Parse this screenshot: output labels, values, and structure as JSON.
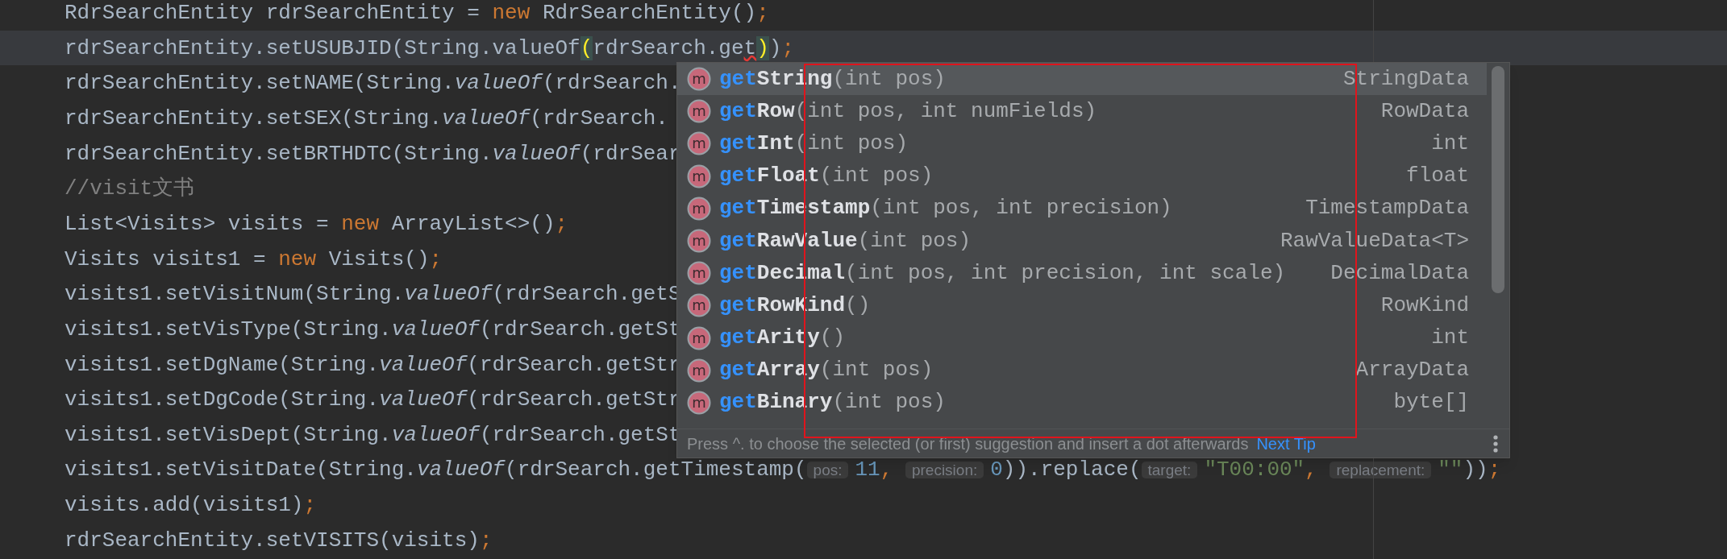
{
  "editor": {
    "lines": [
      {
        "current": false,
        "tokens": [
          {
            "kind": "plain",
            "text": "RdrSearchEntity rdrSearchEntity = "
          },
          {
            "kind": "keyword",
            "text": "new"
          },
          {
            "kind": "plain",
            "text": " RdrSearchEntity()"
          },
          {
            "kind": "keyword",
            "text": ";"
          }
        ]
      },
      {
        "current": true,
        "tokens": [
          {
            "kind": "plain",
            "text": "rdrSearchEntity.setUSUBJID(String.valueOf"
          },
          {
            "kind": "brace_match",
            "text": "("
          },
          {
            "kind": "plain",
            "text": "rdrSearch.ge"
          },
          {
            "kind": "error",
            "text": "t"
          },
          {
            "kind": "brace_match",
            "text": ")"
          },
          {
            "kind": "plain",
            "text": ")"
          },
          {
            "kind": "keyword",
            "text": ";"
          }
        ]
      },
      {
        "current": false,
        "tokens": [
          {
            "kind": "plain",
            "text": "rdrSearchEntity.setNAME(String."
          },
          {
            "kind": "italic",
            "text": "valueOf"
          },
          {
            "kind": "plain",
            "text": "(rdrSearch."
          }
        ]
      },
      {
        "current": false,
        "tokens": [
          {
            "kind": "plain",
            "text": "rdrSearchEntity.setSEX(String."
          },
          {
            "kind": "italic",
            "text": "valueOf"
          },
          {
            "kind": "plain",
            "text": "(rdrSearch."
          }
        ]
      },
      {
        "current": false,
        "tokens": [
          {
            "kind": "plain",
            "text": "rdrSearchEntity.setBRTHDTC(String."
          },
          {
            "kind": "italic",
            "text": "valueOf"
          },
          {
            "kind": "plain",
            "text": "(rdrSear"
          }
        ]
      },
      {
        "current": false,
        "tokens": [
          {
            "kind": "comment",
            "text": "//visit文书"
          }
        ]
      },
      {
        "current": false,
        "tokens": [
          {
            "kind": "plain",
            "text": "List<Visits> visits = "
          },
          {
            "kind": "keyword",
            "text": "new"
          },
          {
            "kind": "plain",
            "text": " ArrayList<>()"
          },
          {
            "kind": "keyword",
            "text": ";"
          }
        ]
      },
      {
        "current": false,
        "tokens": [
          {
            "kind": "plain",
            "text": "Visits visits1 = "
          },
          {
            "kind": "keyword",
            "text": "new"
          },
          {
            "kind": "plain",
            "text": " Visits()"
          },
          {
            "kind": "keyword",
            "text": ";"
          }
        ]
      },
      {
        "current": false,
        "tokens": [
          {
            "kind": "plain",
            "text": "visits1.setVisitNum(String."
          },
          {
            "kind": "italic",
            "text": "valueOf"
          },
          {
            "kind": "plain",
            "text": "(rdrSearch.getS"
          }
        ]
      },
      {
        "current": false,
        "tokens": [
          {
            "kind": "plain",
            "text": "visits1.setVisType(String."
          },
          {
            "kind": "italic",
            "text": "valueOf"
          },
          {
            "kind": "plain",
            "text": "(rdrSearch.getSt"
          }
        ]
      },
      {
        "current": false,
        "tokens": [
          {
            "kind": "plain",
            "text": "visits1.setDgName(String."
          },
          {
            "kind": "italic",
            "text": "valueOf"
          },
          {
            "kind": "plain",
            "text": "(rdrSearch.getStr"
          }
        ]
      },
      {
        "current": false,
        "tokens": [
          {
            "kind": "plain",
            "text": "visits1.setDgCode(String."
          },
          {
            "kind": "italic",
            "text": "valueOf"
          },
          {
            "kind": "plain",
            "text": "(rdrSearch.getStr"
          }
        ]
      },
      {
        "current": false,
        "tokens": [
          {
            "kind": "plain",
            "text": "visits1.setVisDept(String."
          },
          {
            "kind": "italic",
            "text": "valueOf"
          },
          {
            "kind": "plain",
            "text": "(rdrSearch.getSt"
          }
        ]
      },
      {
        "current": false,
        "tokens": [
          {
            "kind": "plain",
            "text": "visits1.setVisitDate(String."
          },
          {
            "kind": "italic",
            "text": "valueOf"
          },
          {
            "kind": "plain",
            "text": "(rdrSearch.getTimestamp("
          },
          {
            "kind": "hint",
            "text": "pos:"
          },
          {
            "kind": "number",
            "text": "11"
          },
          {
            "kind": "keyword",
            "text": ", "
          },
          {
            "kind": "hint",
            "text": "precision:"
          },
          {
            "kind": "number",
            "text": "0"
          },
          {
            "kind": "plain",
            "text": ")).replace("
          },
          {
            "kind": "hint",
            "text": "target:"
          },
          {
            "kind": "string",
            "text": "\"T00:00\""
          },
          {
            "kind": "keyword",
            "text": ", "
          },
          {
            "kind": "hint",
            "text": "replacement:"
          },
          {
            "kind": "string",
            "text": "\"\""
          },
          {
            "kind": "plain",
            "text": "))"
          },
          {
            "kind": "keyword",
            "text": ";"
          }
        ]
      },
      {
        "current": false,
        "tokens": [
          {
            "kind": "plain",
            "text": "visits.add(visits1)"
          },
          {
            "kind": "keyword",
            "text": ";"
          }
        ]
      },
      {
        "current": false,
        "tokens": [
          {
            "kind": "plain",
            "text": "rdrSearchEntity.setVISITS(visits)"
          },
          {
            "kind": "keyword",
            "text": ";"
          }
        ]
      }
    ]
  },
  "completion": {
    "items": [
      {
        "icon": "m",
        "match": "get",
        "rest": "String",
        "params": "(int pos)",
        "type": "StringData",
        "selected": true
      },
      {
        "icon": "m",
        "match": "get",
        "rest": "Row",
        "params": "(int pos, int numFields)",
        "type": "RowData",
        "selected": false
      },
      {
        "icon": "m",
        "match": "get",
        "rest": "Int",
        "params": "(int pos)",
        "type": "int",
        "selected": false
      },
      {
        "icon": "m",
        "match": "get",
        "rest": "Float",
        "params": "(int pos)",
        "type": "float",
        "selected": false
      },
      {
        "icon": "m",
        "match": "get",
        "rest": "Timestamp",
        "params": "(int pos, int precision)",
        "type": "TimestampData",
        "selected": false
      },
      {
        "icon": "m",
        "match": "get",
        "rest": "RawValue",
        "params": "(int pos)",
        "type": "RawValueData<T>",
        "selected": false
      },
      {
        "icon": "m",
        "match": "get",
        "rest": "Decimal",
        "params": "(int pos, int precision, int scale)",
        "type": "DecimalData",
        "selected": false
      },
      {
        "icon": "m",
        "match": "get",
        "rest": "RowKind",
        "params": "()",
        "type": "RowKind",
        "selected": false
      },
      {
        "icon": "m",
        "match": "get",
        "rest": "Arity",
        "params": "()",
        "type": "int",
        "selected": false
      },
      {
        "icon": "m",
        "match": "get",
        "rest": "Array",
        "params": "(int pos)",
        "type": "ArrayData",
        "selected": false
      },
      {
        "icon": "m",
        "match": "get",
        "rest": "Binary",
        "params": "(int pos)",
        "type": "byte[]",
        "selected": false
      }
    ],
    "footer": {
      "hint": "Press ^. to choose the selected (or first) suggestion and insert a dot afterwards",
      "link": "Next Tip"
    }
  }
}
